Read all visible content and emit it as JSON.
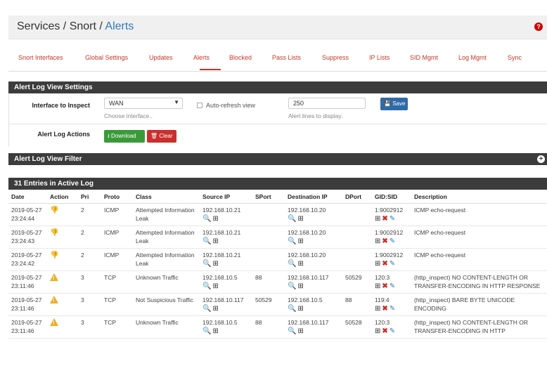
{
  "breadcrumb": {
    "part1": "Services",
    "part2": "Snort",
    "part3": "Alerts",
    "sep": " / "
  },
  "help_icon": "question-circle-icon",
  "tabs": [
    {
      "label": "Snort Interfaces"
    },
    {
      "label": "Global Settings"
    },
    {
      "label": "Updates"
    },
    {
      "label": "Alerts"
    },
    {
      "label": "Blocked"
    },
    {
      "label": "Pass Lists"
    },
    {
      "label": "Suppress"
    },
    {
      "label": "IP Lists"
    },
    {
      "label": "SID Mgmt"
    },
    {
      "label": "Log Mgmt"
    },
    {
      "label": "Sync"
    }
  ],
  "settings_panel": {
    "title": "Alert Log View Settings",
    "interface_label": "Interface to Inspect",
    "interface_value": "WAN",
    "interface_help": "Choose interface..",
    "autorefresh_label": "Auto-refresh view",
    "lines_value": "250",
    "lines_help": "Alert lines to display.",
    "save_label": "Save",
    "actions_label": "Alert Log Actions",
    "download_label": "Download",
    "clear_label": "Clear"
  },
  "filter_panel": {
    "title": "Alert Log View Filter"
  },
  "log_panel": {
    "title": "31 Entries in Active Log"
  },
  "columns": {
    "date": "Date",
    "action": "Action",
    "pri": "Pri",
    "proto": "Proto",
    "class": "Class",
    "src": "Source IP",
    "sport": "SPort",
    "dst": "Destination IP",
    "dport": "DPort",
    "gidsid": "GID:SID",
    "desc": "Description"
  },
  "rows": [
    {
      "date": "2019-05-27",
      "time": "23:24:44",
      "action": "block",
      "pri": "2",
      "proto": "ICMP",
      "class": "Attempted Information Leak",
      "src": "192.168.10.21",
      "sport": "",
      "dst": "192.168.10.20",
      "dport": "",
      "gidsid": "1:9002912",
      "desc": "ICMP echo-request"
    },
    {
      "date": "2019-05-27",
      "time": "23:24:43",
      "action": "block",
      "pri": "2",
      "proto": "ICMP",
      "class": "Attempted Information Leak",
      "src": "192.168.10.21",
      "sport": "",
      "dst": "192.168.10.20",
      "dport": "",
      "gidsid": "1:9002912",
      "desc": "ICMP echo-request"
    },
    {
      "date": "2019-05-27",
      "time": "23:24:42",
      "action": "block",
      "pri": "2",
      "proto": "ICMP",
      "class": "Attempted Information Leak",
      "src": "192.168.10.21",
      "sport": "",
      "dst": "192.168.10.20",
      "dport": "",
      "gidsid": "1:9002912",
      "desc": "ICMP echo-request"
    },
    {
      "date": "2019-05-27",
      "time": "23:11:46",
      "action": "warn",
      "pri": "3",
      "proto": "TCP",
      "class": "Unknown Traffic",
      "src": "192.168.10.5",
      "sport": "88",
      "dst": "192.168.10.117",
      "dport": "50529",
      "gidsid": "120:3",
      "desc": "(http_inspect) NO CONTENT-LENGTH OR TRANSFER-ENCODING IN HTTP RESPONSE"
    },
    {
      "date": "2019-05-27",
      "time": "23:11:46",
      "action": "warn",
      "pri": "3",
      "proto": "TCP",
      "class": "Not Suspicious Traffic",
      "src": "192.168.10.117",
      "sport": "50529",
      "dst": "192.168.10.5",
      "dport": "88",
      "gidsid": "119:4",
      "desc": "(http_inspect) BARE BYTE UNICODE ENCODING"
    },
    {
      "date": "2019-05-27",
      "time": "23:11:46",
      "action": "warn",
      "pri": "3",
      "proto": "TCP",
      "class": "Unknown Traffic",
      "src": "192.168.10.5",
      "sport": "88",
      "dst": "192.168.10.117",
      "dport": "50528",
      "gidsid": "120:3",
      "desc": "(http_inspect) NO CONTENT-LENGTH OR TRANSFER-ENCODING IN HTTP"
    }
  ],
  "colors": {
    "accent": "#c0392b",
    "panel_header": "#3c3c3c",
    "link": "#337ab7",
    "save": "#2f6aa8",
    "download": "#3a9a3a",
    "clear": "#c9302c",
    "warning": "#f0ad1e"
  }
}
